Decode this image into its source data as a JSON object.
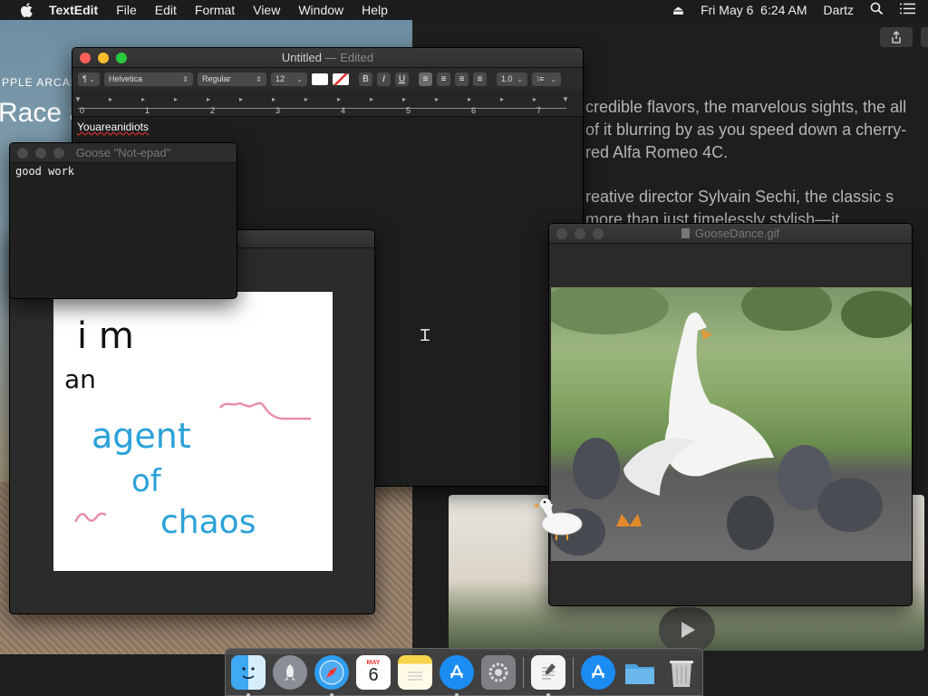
{
  "menubar": {
    "app": "TextEdit",
    "menus": [
      "File",
      "Edit",
      "Format",
      "View",
      "Window",
      "Help"
    ],
    "datetime": "Fri May 6  6:24 AM",
    "user": "Dartz"
  },
  "background": {
    "overline": "PPLE ARCAD",
    "headline": "Race a",
    "article": [
      "credible flavors, the marvelous sights, the all of it blurring by as you speed down a cherry-red Alfa Romeo 4C.",
      "reative director Sylvain Sechi, the classic s more than just timelessly stylish—it"
    ]
  },
  "textedit": {
    "title": "Untitled",
    "status": " — Edited",
    "toolbar": {
      "paragraph": "¶",
      "font": "Helvetica",
      "style": "Regular",
      "size": "12",
      "bold": "B",
      "italic": "I",
      "underline": "U",
      "spacing": "1.0"
    },
    "ruler": [
      "0",
      "1",
      "2",
      "3",
      "4",
      "5",
      "6",
      "7"
    ],
    "content": "Youareanidiots"
  },
  "notepad": {
    "title": "Goose \"Not-epad\"",
    "content": "good work"
  },
  "drawing": {
    "lines": [
      "i m",
      "an",
      "agent",
      "of",
      "chaos"
    ]
  },
  "gif_window": {
    "title": "GooseDance.gif"
  },
  "dock": {
    "calendar_month": "MAY",
    "calendar_day": "6"
  },
  "colors": {
    "menubar": "#1c1c1e",
    "close": "#fe5f57",
    "minimize": "#febc2e",
    "zoom": "#28c840",
    "ink_black": "#111111",
    "ink_blue": "#2aa1d9",
    "ink_pink": "#e88fa8"
  },
  "icons": [
    "apple-icon",
    "eject-icon",
    "search-icon",
    "list-icon",
    "share-icon",
    "play-icon",
    "ibeam-cursor-icon",
    "finder-icon",
    "launchpad-icon",
    "safari-icon",
    "calendar-icon",
    "notes-icon",
    "app-store-icon",
    "system-preferences-icon",
    "textedit-icon",
    "folder-icon",
    "trash-icon"
  ]
}
